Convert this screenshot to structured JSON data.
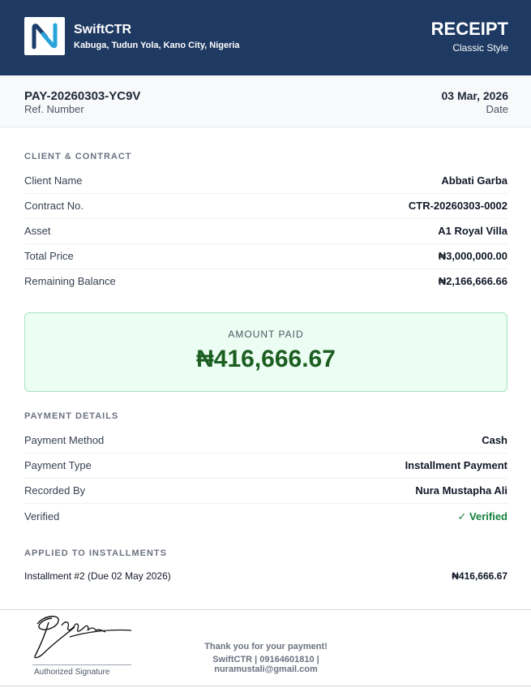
{
  "header": {
    "logo_icon": "swiftctr-logo-icon",
    "brand_name": "SwiftCTR",
    "address": "Kabuga, Tudun Yola, Kano City, Nigeria",
    "title": "RECEIPT",
    "style": "Classic Style",
    "color": "#1e3a62"
  },
  "reference": {
    "number": "PAY-20260303-YC9V",
    "number_label": "Ref. Number",
    "date": "03 Mar, 2026",
    "date_label": "Date"
  },
  "client_section": {
    "title": "CLIENT & CONTRACT",
    "rows": [
      {
        "label": "Client Name",
        "value": "Abbati Garba"
      },
      {
        "label": "Contract No.",
        "value": "CTR-20260303-0002"
      },
      {
        "label": "Asset",
        "value": "A1 Royal Villa"
      },
      {
        "label": "Total Price",
        "value": "₦3,000,000.00"
      },
      {
        "label": "Remaining Balance",
        "value": "₦2,166,666.66"
      }
    ]
  },
  "amount_paid": {
    "label": "AMOUNT PAID",
    "value": "₦416,666.67",
    "color": "#1b5e20"
  },
  "payment_section": {
    "title": "PAYMENT DETAILS",
    "rows": [
      {
        "label": "Payment Method",
        "value": "Cash"
      },
      {
        "label": "Payment Type",
        "value": "Installment Payment"
      },
      {
        "label": "Recorded By",
        "value": "Nura Mustapha Ali"
      },
      {
        "label": "Verified",
        "value": "✓ Verified"
      }
    ]
  },
  "installments_section": {
    "title": "APPLIED TO INSTALLMENTS",
    "items": [
      {
        "label": "Installment #2 (Due 02 May 2026)",
        "value": "₦416,666.67"
      }
    ]
  },
  "footer": {
    "signature_label": "Authorized Signature",
    "thanks": "Thank you for your payment!",
    "contact": "SwiftCTR | 09164601810 | nuramustali@gmail.com"
  }
}
